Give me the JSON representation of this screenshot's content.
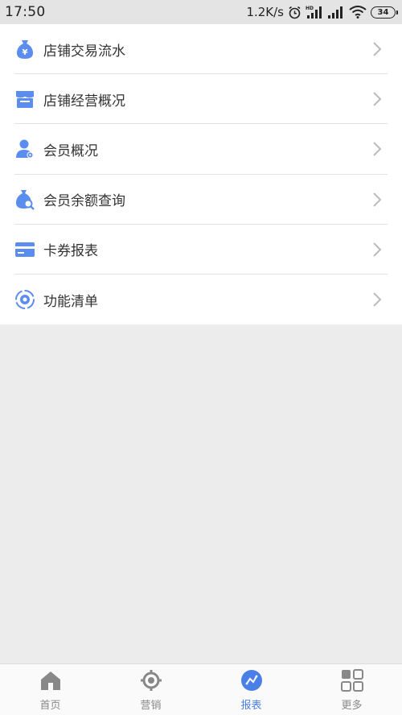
{
  "status_bar": {
    "time": "17:50",
    "network_speed": "1.2K/s",
    "battery": "34",
    "icons": [
      "alarm-icon",
      "hd-signal-icon",
      "signal-icon",
      "wifi-icon",
      "battery-icon"
    ]
  },
  "colors": {
    "accent": "#4a7fe8",
    "icon_blue": "#5b8def",
    "chevron": "#bbbbbb",
    "background": "#ececec",
    "nav_inactive": "#888888"
  },
  "menu": {
    "items": [
      {
        "label": "店铺交易流水",
        "icon": "money-bag-icon"
      },
      {
        "label": "店铺经营概况",
        "icon": "store-icon"
      },
      {
        "label": "会员概况",
        "icon": "member-icon"
      },
      {
        "label": "会员余额查询",
        "icon": "balance-search-icon"
      },
      {
        "label": "卡券报表",
        "icon": "card-icon"
      },
      {
        "label": "功能清单",
        "icon": "settings-icon"
      }
    ]
  },
  "bottom_nav": {
    "items": [
      {
        "label": "首页",
        "icon": "home-icon",
        "active": false
      },
      {
        "label": "营销",
        "icon": "target-icon",
        "active": false
      },
      {
        "label": "报表",
        "icon": "chart-icon",
        "active": true
      },
      {
        "label": "更多",
        "icon": "grid-icon",
        "active": false
      }
    ]
  }
}
